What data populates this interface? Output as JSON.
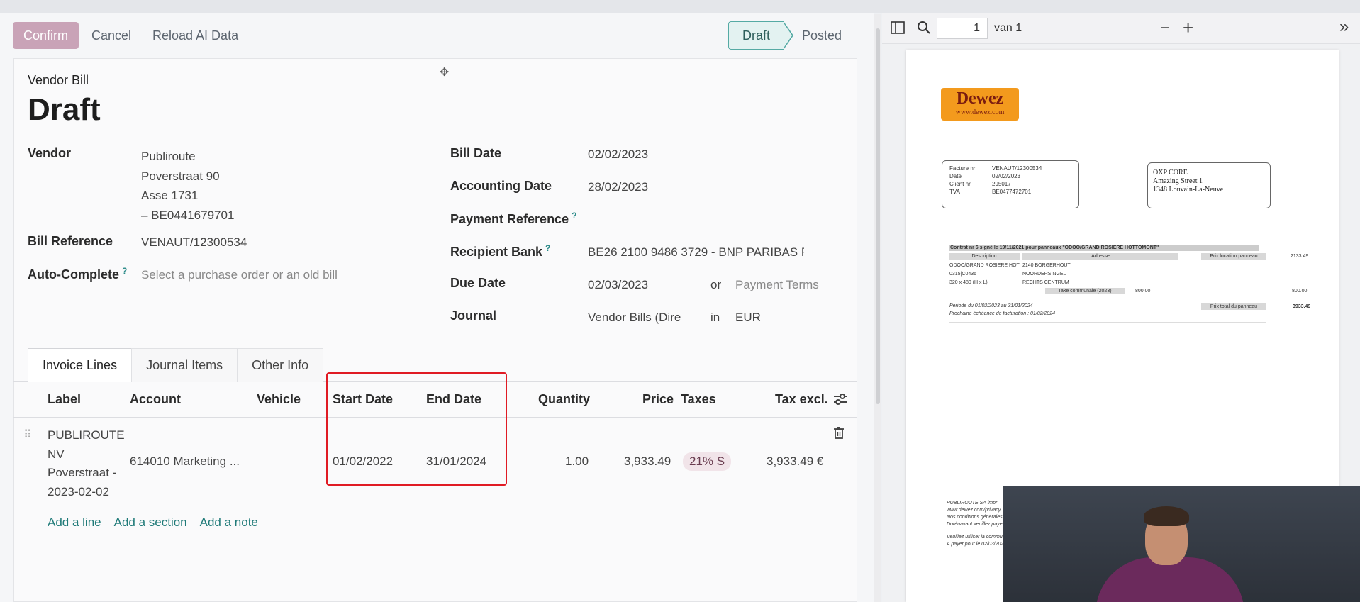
{
  "toolbar": {
    "confirm": "Confirm",
    "cancel": "Cancel",
    "reload": "Reload AI Data"
  },
  "status": {
    "steps": [
      "Draft",
      "Posted"
    ],
    "active": "Draft"
  },
  "record": {
    "type": "Vendor Bill",
    "state": "Draft"
  },
  "fields": {
    "vendor_label": "Vendor",
    "vendor_lines": [
      "Publiroute",
      "Poverstraat 90",
      "Asse 1731",
      "– BE0441679701"
    ],
    "bill_ref_label": "Bill Reference",
    "bill_ref": "VENAUT/12300534",
    "autocomplete_label": "Auto-Complete",
    "autocomplete_placeholder": "Select a purchase order or an old bill",
    "bill_date_label": "Bill Date",
    "bill_date": "02/02/2023",
    "accounting_date_label": "Accounting Date",
    "accounting_date": "28/02/2023",
    "payment_ref_label": "Payment Reference",
    "recipient_bank_label": "Recipient Bank",
    "recipient_bank": "BE26 2100 9486 3729 - BNP PARIBAS F",
    "due_date_label": "Due Date",
    "due_date": "02/03/2023",
    "due_or": "or",
    "payment_terms_placeholder": "Payment Terms",
    "journal_label": "Journal",
    "journal": "Vendor Bills (Dire",
    "journal_in": "in",
    "currency": "EUR",
    "help_mark": "?"
  },
  "tabs": [
    "Invoice Lines",
    "Journal Items",
    "Other Info"
  ],
  "table": {
    "headers": [
      "Label",
      "Account",
      "Vehicle",
      "Start Date",
      "End Date",
      "Quantity",
      "Price",
      "Taxes",
      "Tax excl."
    ],
    "row": {
      "label_lines": [
        "PUBLIROUTE",
        "NV",
        "Poverstraat -",
        "2023-02-02"
      ],
      "account": "614010 Marketing ...",
      "vehicle": "",
      "start_date": "01/02/2022",
      "end_date": "31/01/2024",
      "quantity": "1.00",
      "price": "3,933.49",
      "taxes": "21% S",
      "tax_excl": "3,933.49 €"
    },
    "add_links": [
      "Add a line",
      "Add a section",
      "Add a note"
    ]
  },
  "viewer": {
    "page": "1",
    "page_of": "van 1"
  },
  "pdf": {
    "logo_name": "Dewez",
    "logo_url": "www.dewez.com",
    "info_rows": [
      [
        "Facture nr",
        "VENAUT/12300534"
      ],
      [
        "Date",
        "02/02/2023"
      ],
      [
        "Client nr",
        "295017"
      ],
      [
        "TVA",
        "BE0477472701"
      ]
    ],
    "address_lines": [
      "OXP CORE",
      "Amazing Street 1",
      "1348 Louvain-La-Neuve"
    ],
    "contract_line": "Contrat nr 6 signé le 19/11/2021 pour panneaux \"ODOO/GRAND ROSIERE HOTTOMONT\"",
    "col_description": "Description",
    "col_adresse": "Adresse",
    "col_prix": "Prix location panneau",
    "desc_lines": [
      "ODOO/GRAND ROSIERE HOT",
      "0315|C0436",
      "320 x 480  (H x L)"
    ],
    "addr_lines": [
      "2140 BORGERHOUT",
      "NOORDERSINGEL",
      "RECHTS CENTRUM"
    ],
    "price_location": "2133.49",
    "taxe_label": "Taxe communale (2023)",
    "taxe_mid": "800.00",
    "taxe_right": "800.00",
    "period": "Periode du 01/02/2023 au 31/01/2024",
    "next_billing": "Prochaine échéance de facturation : 01/02/2024",
    "total_label": "Prix total du panneau",
    "total": "3933.49",
    "footer_lines": [
      "PUBLIROUTE SA impr",
      "www.dewez.com/privacy",
      "Nos conditions générales",
      "Dorénavant veuillez payer",
      "Veuillez utiliser la commun",
      "A payer pour le 02/03/202"
    ]
  }
}
